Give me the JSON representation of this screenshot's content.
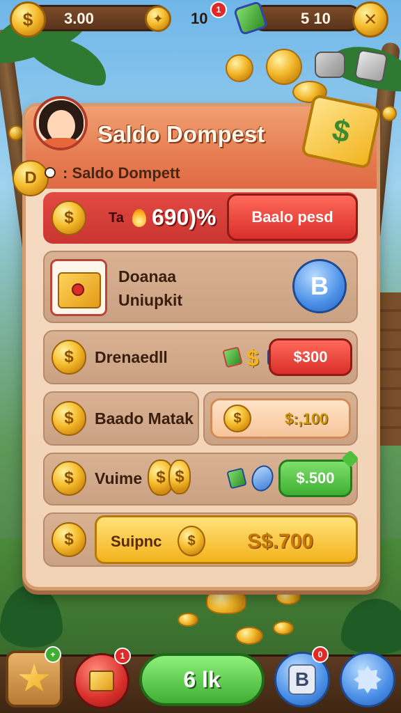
{
  "topbar": {
    "coins_value": "3.00",
    "center_value": "10",
    "center_badge": "1",
    "right_value": "5 10",
    "coin_icon": "coin-icon",
    "close_icon": "close-icon"
  },
  "panel": {
    "title": "Saldo Dompest",
    "subtitle": ": Saldo Dompett",
    "gem_symbol": "$",
    "balance_row": {
      "prefix": "Ta",
      "value": "690)%",
      "button_label": "Baalo pesd"
    },
    "rows": [
      {
        "label_line1": "Doanaa",
        "label_line2": "Uniupkit",
        "button_label": "B"
      },
      {
        "label": "Drenaedll",
        "button_label": "$300"
      },
      {
        "label": "Baado Matak",
        "button_label": "$:,100"
      },
      {
        "label": "Vuime",
        "button_label": "$.500"
      },
      {
        "label": "Suipnc",
        "button_label": "S$.700"
      }
    ]
  },
  "bottom_nav": {
    "left_badge": "+",
    "red_badge": "1",
    "main_button": "6 lk",
    "blue_letter": "B",
    "blue_badge": "0"
  },
  "colors": {
    "accent_red": "#d92e2a",
    "accent_green": "#3fae32",
    "accent_gold": "#f4b21c",
    "panel_bg": "#f6dcc5"
  }
}
